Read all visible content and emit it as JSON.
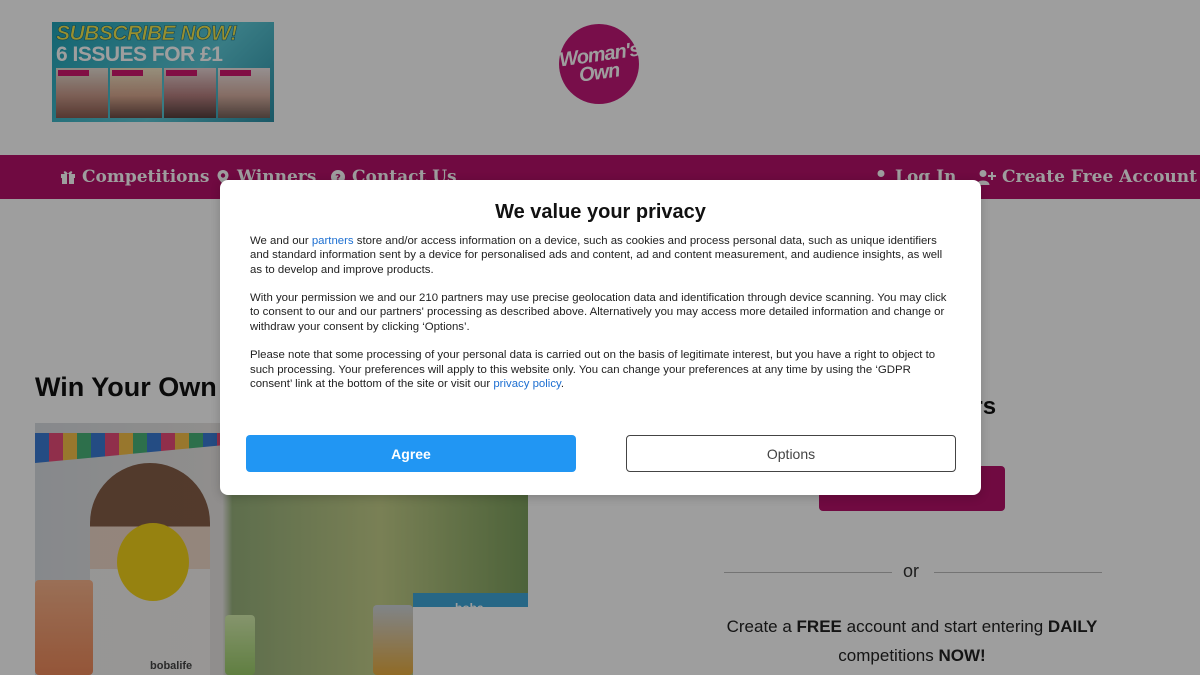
{
  "header": {
    "promo": {
      "line1": "SUBSCRIBE NOW!",
      "line2": "6 ISSUES FOR £1"
    },
    "logo": {
      "line1": "Woman's",
      "line2": "Own"
    }
  },
  "nav": {
    "competitions": "Competitions",
    "winners": "Winners",
    "contact": "Contact Us",
    "login": "Log In",
    "create_account": "Create Free Account"
  },
  "main": {
    "title": "Win Your Own",
    "hero_box_label": "boba",
    "hero_brand": "bobalife"
  },
  "side": {
    "heading": "ers",
    "or": "or",
    "cta_parts": [
      "Create a ",
      "FREE",
      " account and start entering ",
      "DAILY",
      " competitions ",
      "NOW!"
    ]
  },
  "consent": {
    "title": "We value your privacy",
    "p1_pre": "We and our ",
    "p1_link": "partners",
    "p1_post": " store and/or access information on a device, such as cookies and process personal data, such as unique identifiers and standard information sent by a device for personalised ads and content, ad and content measurement, and audience insights, as well as to develop and improve products.",
    "p2": "With your permission we and our 210 partners may use precise geolocation data and identification through device scanning. You may click to consent to our and our partners' processing as described above. Alternatively you may access more detailed information and change or withdraw your consent by clicking ‘Options’.",
    "p3_pre": "Please note that some processing of your personal data is carried out on the basis of legitimate interest, but you have a right to object to such processing. Your preferences will apply to this website only. You can change your preferences at any time by using the ‘GDPR consent’ link at the bottom of the site or visit our ",
    "p3_link": "privacy policy",
    "p3_post": ".",
    "agree_label": "Agree",
    "options_label": "Options"
  },
  "colors": {
    "brand": "#b51169",
    "agree_button": "#2196f3",
    "link": "#1d6fd1"
  },
  "icons": [
    "gift-icon",
    "map-marker-icon",
    "question-circle-icon",
    "user-icon",
    "user-plus-icon"
  ]
}
